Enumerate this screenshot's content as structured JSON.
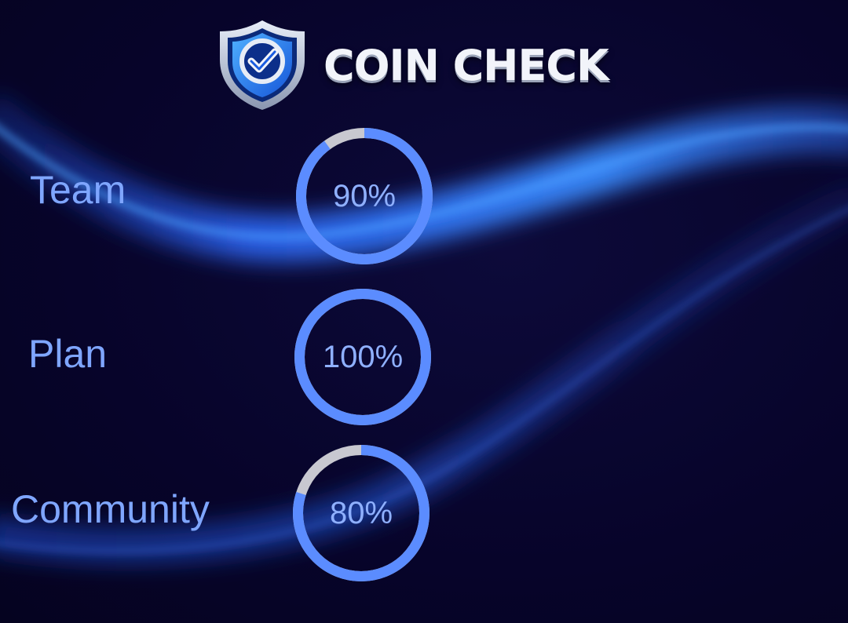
{
  "brand": {
    "title": "COIN CHECK",
    "logo_icon": "shield-check-icon"
  },
  "metrics": [
    {
      "label": "Team",
      "value_text": "90%",
      "value": 90
    },
    {
      "label": "Plan",
      "value_text": "100%",
      "value": 100
    },
    {
      "label": "Community",
      "value_text": "80%",
      "value": 80
    }
  ],
  "colors": {
    "background": "#08052a",
    "ring_progress": "#5b8cff",
    "ring_track": "#c8c8d0",
    "label": "#7fa6ff",
    "value_text": "#8fb0ff",
    "title": "#f2f4fa"
  }
}
